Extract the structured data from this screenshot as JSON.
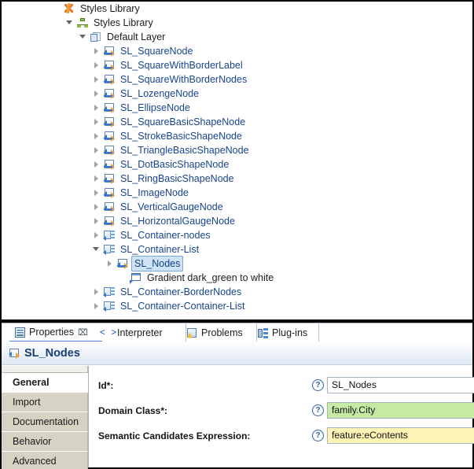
{
  "tree": {
    "name": "model-explorer-tree",
    "rows": [
      {
        "label": "Styles Library",
        "icon": "styles-root-icon",
        "depth": 0,
        "twisty": "none",
        "selected": false,
        "color": "dark"
      },
      {
        "label": "Styles Library",
        "icon": "viewpoint-icon",
        "depth": 1,
        "twisty": "expanded",
        "selected": false,
        "color": "dark"
      },
      {
        "label": "Default Layer",
        "icon": "layer-icon",
        "depth": 2,
        "twisty": "expanded",
        "selected": false,
        "color": "dark"
      },
      {
        "label": "SL_SquareNode",
        "icon": "node-mapping-icon",
        "depth": 3,
        "twisty": "collapsed",
        "selected": false,
        "color": "blue"
      },
      {
        "label": "SL_SquareWithBorderLabel",
        "icon": "node-mapping-icon",
        "depth": 3,
        "twisty": "collapsed",
        "selected": false,
        "color": "blue"
      },
      {
        "label": "SL_SquareWithBorderNodes",
        "icon": "node-mapping-icon",
        "depth": 3,
        "twisty": "collapsed",
        "selected": false,
        "color": "blue"
      },
      {
        "label": "SL_LozengeNode",
        "icon": "node-mapping-icon",
        "depth": 3,
        "twisty": "collapsed",
        "selected": false,
        "color": "blue"
      },
      {
        "label": "SL_EllipseNode",
        "icon": "node-mapping-icon",
        "depth": 3,
        "twisty": "collapsed",
        "selected": false,
        "color": "blue"
      },
      {
        "label": "SL_SquareBasicShapeNode",
        "icon": "node-mapping-icon",
        "depth": 3,
        "twisty": "collapsed",
        "selected": false,
        "color": "blue"
      },
      {
        "label": "SL_StrokeBasicShapeNode",
        "icon": "node-mapping-icon",
        "depth": 3,
        "twisty": "collapsed",
        "selected": false,
        "color": "blue"
      },
      {
        "label": "SL_TriangleBasicShapeNode",
        "icon": "node-mapping-icon",
        "depth": 3,
        "twisty": "collapsed",
        "selected": false,
        "color": "blue"
      },
      {
        "label": "SL_DotBasicShapeNode",
        "icon": "node-mapping-icon",
        "depth": 3,
        "twisty": "collapsed",
        "selected": false,
        "color": "blue"
      },
      {
        "label": "SL_RingBasicShapeNode",
        "icon": "node-mapping-icon",
        "depth": 3,
        "twisty": "collapsed",
        "selected": false,
        "color": "blue"
      },
      {
        "label": "SL_ImageNode",
        "icon": "node-mapping-icon",
        "depth": 3,
        "twisty": "collapsed",
        "selected": false,
        "color": "blue"
      },
      {
        "label": "SL_VerticalGaugeNode",
        "icon": "node-mapping-icon",
        "depth": 3,
        "twisty": "collapsed",
        "selected": false,
        "color": "blue"
      },
      {
        "label": "SL_HorizontalGaugeNode",
        "icon": "node-mapping-icon",
        "depth": 3,
        "twisty": "collapsed",
        "selected": false,
        "color": "blue"
      },
      {
        "label": "SL_Container-nodes",
        "icon": "container-mapping-icon",
        "depth": 3,
        "twisty": "collapsed",
        "selected": false,
        "color": "blue"
      },
      {
        "label": "SL_Container-List",
        "icon": "container-mapping-icon",
        "depth": 3,
        "twisty": "expanded",
        "selected": false,
        "color": "blue"
      },
      {
        "label": "SL_Nodes",
        "icon": "node-mapping-icon",
        "depth": 4,
        "twisty": "collapsed",
        "selected": true,
        "color": "blue"
      },
      {
        "label": "Gradient  dark_green to white",
        "icon": "gradient-icon",
        "depth": 5,
        "twisty": "none",
        "selected": false,
        "color": "dark"
      },
      {
        "label": "SL_Container-BorderNodes",
        "icon": "container-mapping-icon",
        "depth": 3,
        "twisty": "collapsed",
        "selected": false,
        "color": "blue"
      },
      {
        "label": "SL_Container-Container-List",
        "icon": "container-mapping-icon",
        "depth": 3,
        "twisty": "collapsed",
        "selected": false,
        "color": "blue"
      }
    ]
  },
  "tabstrip": {
    "tabs": [
      {
        "label": "Properties",
        "icon": "properties-icon",
        "active": true,
        "closable": true,
        "close_glyph": "⌧"
      },
      {
        "label": "Interpreter",
        "icon": "code-brackets-icon",
        "active": false,
        "closable": false,
        "glyph": "< >"
      },
      {
        "label": "Problems",
        "icon": "problems-warning-icon",
        "active": false,
        "closable": false
      },
      {
        "label": "Plug-ins",
        "icon": "plugins-icon",
        "active": false,
        "closable": false
      }
    ]
  },
  "properties": {
    "header_title": "SL_Nodes",
    "header_icon": "node-mapping-icon",
    "side_tabs": [
      {
        "label": "General",
        "active": true
      },
      {
        "label": "Import",
        "active": false
      },
      {
        "label": "Documentation",
        "active": false
      },
      {
        "label": "Behavior",
        "active": false
      },
      {
        "label": "Advanced",
        "active": false
      }
    ],
    "fields": [
      {
        "label": "Id*:",
        "value": "SL_Nodes",
        "style": "plain",
        "help_glyph": "?"
      },
      {
        "label": "Domain Class*:",
        "value": "family.City",
        "style": "green",
        "help_glyph": "?"
      },
      {
        "label": "Semantic Candidates Expression:",
        "value": "feature:eContents",
        "style": "yellow",
        "help_glyph": "?"
      }
    ]
  },
  "colors": {
    "selection_bg": "#cfe3f7",
    "selection_border": "#7aa7d4",
    "link_blue": "#18448c",
    "valid_green": "#c4eaa4",
    "expression_yellow": "#fdf3b5",
    "accent_blue": "#4d8ad4"
  }
}
